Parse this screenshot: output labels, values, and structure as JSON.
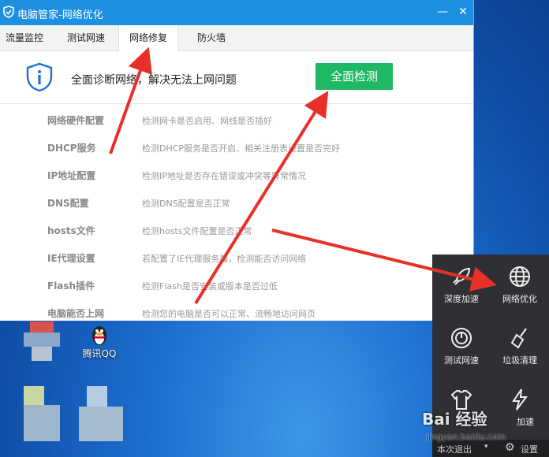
{
  "window": {
    "title": "电脑管家-网络优化",
    "minimize_glyph": "—",
    "close_glyph": "✕"
  },
  "tabs": [
    {
      "label": "流量监控",
      "active": false
    },
    {
      "label": "测试网速",
      "active": false
    },
    {
      "label": "网络修复",
      "active": true
    },
    {
      "label": "防火墙",
      "active": false
    }
  ],
  "header": {
    "description": "全面诊断网络，解决无法上网问题",
    "scan_button": "全面检测"
  },
  "checks": [
    {
      "name": "网络硬件配置",
      "info": "检测网卡是否启用、网线是否插好"
    },
    {
      "name": "DHCP服务",
      "info": "检测DHCP服务是否开启、相关注册表设置是否完好"
    },
    {
      "name": "IP地址配置",
      "info": "检测IP地址是否存在错误或冲突等异常情况"
    },
    {
      "name": "DNS配置",
      "info": "检测DNS配置是否正常"
    },
    {
      "name": "hosts文件",
      "info": "检测hosts文件配置是否正常"
    },
    {
      "name": "IE代理设置",
      "info": "若配置了IE代理服务器，检测能否访问网络"
    },
    {
      "name": "Flash插件",
      "info": "检测Flash是否安装或版本是否过低"
    },
    {
      "name": "电脑能否上网",
      "info": "检测您的电脑是否可以正常、流畅地访问网页"
    }
  ],
  "desktop": {
    "icons": [
      {
        "label": "腾讯QQ"
      }
    ]
  },
  "panel": {
    "tiles": [
      {
        "label": "深度加速",
        "icon": "rocket-icon"
      },
      {
        "label": "网络优化",
        "icon": "globe-icon"
      },
      {
        "label": "测试网速",
        "icon": "speedometer-icon"
      },
      {
        "label": "垃圾清理",
        "icon": "broom-icon"
      },
      {
        "label": "",
        "icon": "tshirt-icon"
      },
      {
        "label": "加速",
        "icon": "flash-icon"
      }
    ],
    "footer": {
      "exit_label": "本次退出",
      "settings_label": "设置"
    }
  },
  "watermark": {
    "brand": "Bai 经验",
    "url": "jingyan.baidu.com"
  },
  "colors": {
    "titlebar": "#1d8fe1",
    "scan_button": "#1fb864",
    "arrow": "#e8302a",
    "panel": "#2f3033"
  }
}
